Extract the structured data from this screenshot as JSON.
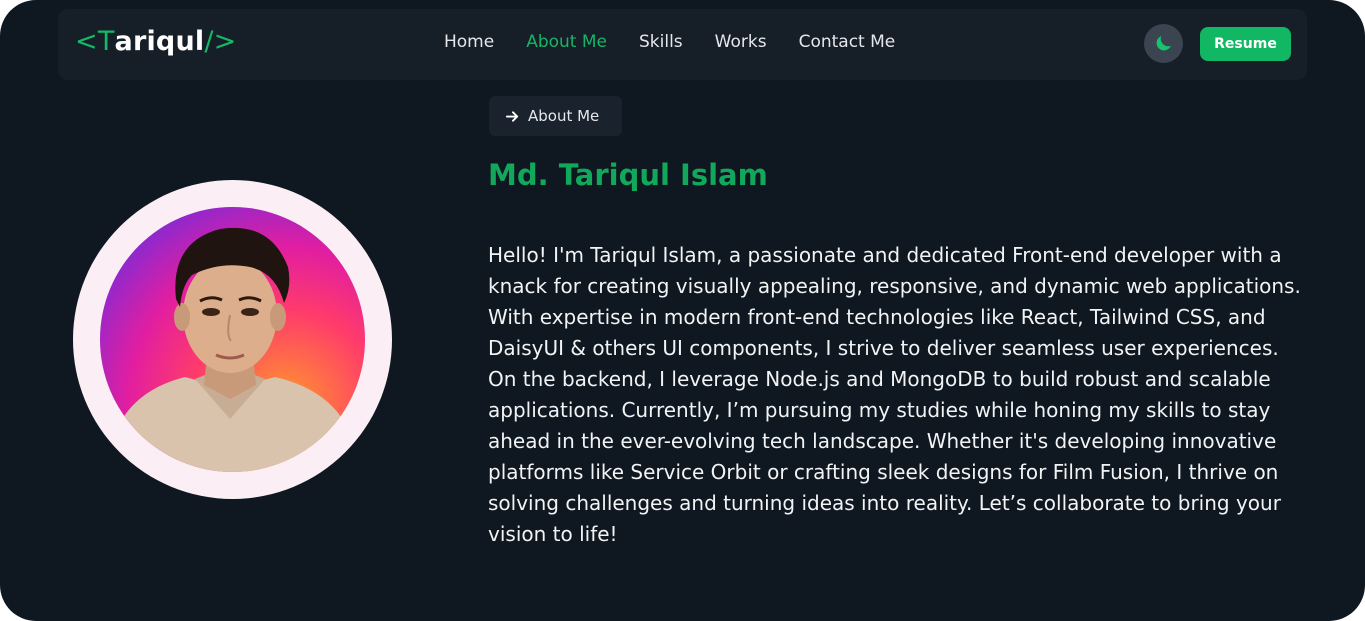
{
  "logo": {
    "open": "<",
    "initial": "T",
    "rest": "ariqul",
    "close": "/>"
  },
  "nav": {
    "items": [
      {
        "label": "Home",
        "active": false
      },
      {
        "label": "About Me",
        "active": true
      },
      {
        "label": "Skills",
        "active": false
      },
      {
        "label": "Works",
        "active": false
      },
      {
        "label": "Contact Me",
        "active": false
      }
    ]
  },
  "theme_toggle": {
    "icon": "moon-icon"
  },
  "resume_button": {
    "label": "Resume"
  },
  "section": {
    "tag_label": "About Me",
    "tag_icon": "arrow-right-icon",
    "name": "Md. Tariqul Islam",
    "bio": "Hello! I'm Tariqul Islam, a passionate and dedicated Front-end developer with a knack for creating visually appealing, responsive, and dynamic web applications. With expertise in modern front-end technologies like React, Tailwind CSS, and DaisyUI & others UI components, I strive to deliver seamless user experiences. On the backend, I leverage Node.js and MongoDB to build robust and scalable applications. Currently, I’m pursuing my studies while honing my skills to stay ahead in the ever-evolving tech landscape. Whether it's developing innovative platforms like Service Orbit or crafting sleek designs for Film Fusion, I thrive on solving challenges and turning ideas into reality. Let’s collaborate to bring your vision to life!"
  },
  "colors": {
    "background": "#0f1720",
    "navbar": "#161e28",
    "accent": "#12b764",
    "heading": "#11a85c",
    "text": "#f1f3f5"
  }
}
